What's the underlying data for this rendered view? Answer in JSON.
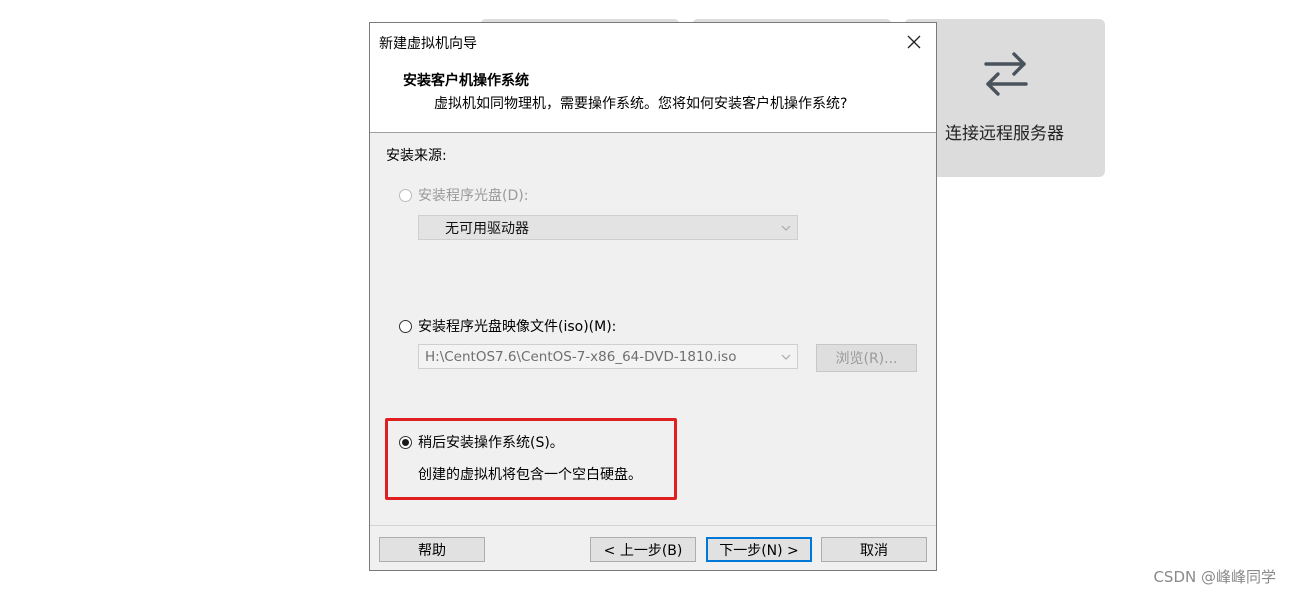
{
  "background": {
    "connect_tile": {
      "label": "连接远程服务器",
      "icon": "swap-arrows-icon"
    }
  },
  "dialog": {
    "title": "新建虚拟机向导",
    "close_icon": "close-icon",
    "header": {
      "title": "安装客户机操作系统",
      "subtitle": "虚拟机如同物理机，需要操作系统。您将如何安装客户机操作系统?"
    },
    "source_label": "安装来源:",
    "options": {
      "disc": {
        "label": "安装程序光盘(D):",
        "enabled": false,
        "selected": false,
        "drive_value": "无可用驱动器"
      },
      "iso": {
        "label": "安装程序光盘映像文件(iso)(M):",
        "enabled": true,
        "selected": false,
        "path_value": "H:\\CentOS7.6\\CentOS-7-x86_64-DVD-1810.iso",
        "browse_label": "浏览(R)..."
      },
      "later": {
        "label": "稍后安装操作系统(S)。",
        "selected": true,
        "description": "创建的虚拟机将包含一个空白硬盘。"
      }
    },
    "buttons": {
      "help": "帮助",
      "back": "< 上一步(B)",
      "next": "下一步(N) >",
      "cancel": "取消"
    }
  },
  "watermark": "CSDN @峰峰同学",
  "colors": {
    "highlight": "#e02020",
    "focus": "#0078d7",
    "tile": "#dcdcdc",
    "body": "#f0f0f0"
  }
}
